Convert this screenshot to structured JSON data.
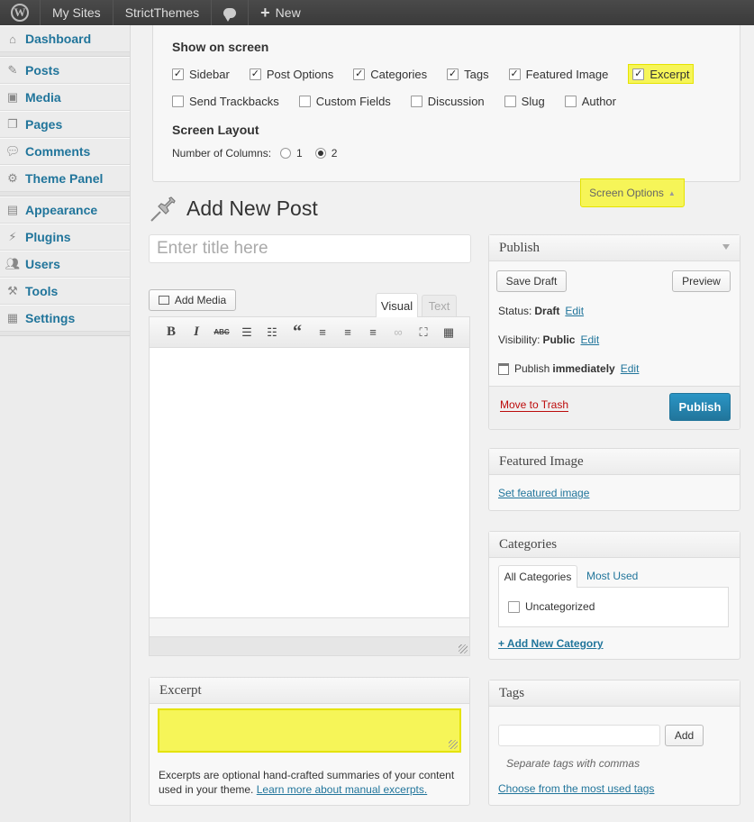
{
  "adminbar": {
    "logo": "W",
    "my_sites": "My Sites",
    "site_name": "StrictThemes",
    "new_label": "New"
  },
  "sidebar": {
    "items": [
      {
        "label": "Dashboard",
        "icon": "dashboard-icon"
      },
      {
        "label": "Posts",
        "icon": "pin-icon"
      },
      {
        "label": "Media",
        "icon": "media-icon"
      },
      {
        "label": "Pages",
        "icon": "pages-icon"
      },
      {
        "label": "Comments",
        "icon": "comments-icon"
      },
      {
        "label": "Theme Panel",
        "icon": "gear-icon"
      },
      {
        "label": "Appearance",
        "icon": "appearance-icon"
      },
      {
        "label": "Plugins",
        "icon": "plugins-icon"
      },
      {
        "label": "Users",
        "icon": "users-icon"
      },
      {
        "label": "Tools",
        "icon": "tools-icon"
      },
      {
        "label": "Settings",
        "icon": "settings-icon"
      }
    ]
  },
  "screen_options": {
    "show_heading": "Show on screen",
    "row1": [
      {
        "label": "Sidebar",
        "checked": true
      },
      {
        "label": "Post Options",
        "checked": true
      },
      {
        "label": "Categories",
        "checked": true
      },
      {
        "label": "Tags",
        "checked": true
      },
      {
        "label": "Featured Image",
        "checked": true
      },
      {
        "label": "Excerpt",
        "checked": true
      }
    ],
    "row2": [
      {
        "label": "Send Trackbacks",
        "checked": false
      },
      {
        "label": "Custom Fields",
        "checked": false
      },
      {
        "label": "Discussion",
        "checked": false
      },
      {
        "label": "Slug",
        "checked": false
      },
      {
        "label": "Author",
        "checked": false
      }
    ],
    "layout_heading": "Screen Layout",
    "columns_label": "Number of Columns:",
    "col1": "1",
    "col2": "2",
    "selected_columns": "2",
    "tab_label": "Screen Options",
    "highlight_color": "#f6f558"
  },
  "page": {
    "title": "Add New Post",
    "title_placeholder": "Enter title here"
  },
  "editor": {
    "add_media": "Add Media",
    "tab_visual": "Visual",
    "tab_text": "Text",
    "toolbar": [
      "bold-icon",
      "italic-icon",
      "strikethrough-icon",
      "bullet-list-icon",
      "numbered-list-icon",
      "blockquote-icon",
      "align-left-icon",
      "align-center-icon",
      "align-right-icon",
      "link-icon",
      "fullscreen-icon",
      "kitchen-sink-icon"
    ]
  },
  "publish": {
    "heading": "Publish",
    "save_draft": "Save Draft",
    "preview": "Preview",
    "status_label": "Status:",
    "status_value": "Draft",
    "visibility_label": "Visibility:",
    "visibility_value": "Public",
    "publish_label": "Publish",
    "publish_value": "immediately",
    "edit": "Edit",
    "trash": "Move to Trash",
    "publish_button": "Publish",
    "button_color": "#21759b"
  },
  "featured": {
    "heading": "Featured Image",
    "link": "Set featured image"
  },
  "categories": {
    "heading": "Categories",
    "tab_all": "All Categories",
    "tab_used": "Most Used",
    "item": "Uncategorized",
    "add_link": "+ Add New Category"
  },
  "excerpt": {
    "heading": "Excerpt",
    "help": "Excerpts are optional hand-crafted summaries of your content used in your theme.",
    "help_link": "Learn more about manual excerpts."
  },
  "tags": {
    "heading": "Tags",
    "add": "Add",
    "hint": "Separate tags with commas",
    "choose": "Choose from the most used tags"
  }
}
